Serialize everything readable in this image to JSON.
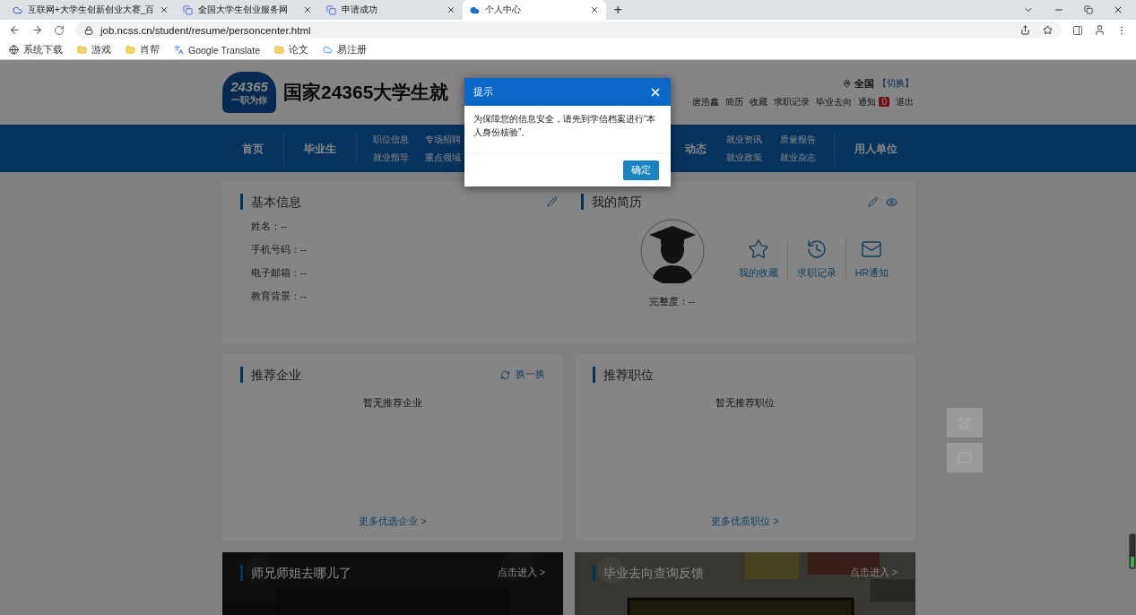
{
  "browser": {
    "tabs": [
      {
        "title": "互联网+大学生创新创业大赛_百",
        "selected": false
      },
      {
        "title": "全国大学生创业服务网",
        "selected": false
      },
      {
        "title": "申请成功",
        "selected": false
      },
      {
        "title": "个人中心",
        "selected": true
      }
    ],
    "new_tab": "+",
    "url": "job.ncss.cn/student/resume/personcenter.html",
    "bookmarks": [
      "系统下载",
      "游戏",
      "肖帮",
      "Google Translate",
      "论文",
      "易注册"
    ]
  },
  "header": {
    "logo_number": "24365",
    "logo_slogan": "一职为你",
    "site_title": "国家24365大学生就",
    "location": "全国",
    "switch": "【切换】",
    "user_links": [
      {
        "label": "唐浩鑫",
        "kind": "user"
      },
      {
        "label": "简历",
        "kind": "link"
      },
      {
        "label": "收藏",
        "kind": "link"
      },
      {
        "label": "求职记录",
        "kind": "link"
      },
      {
        "label": "毕业去向",
        "kind": "link"
      },
      {
        "label": "通知",
        "kind": "notice",
        "badge": "0"
      },
      {
        "label": "退出",
        "kind": "link"
      }
    ]
  },
  "nav": {
    "left": [
      {
        "label": "首页"
      },
      {
        "label": "毕业生"
      }
    ],
    "left_sub": [
      [
        "职位信息",
        "就业指导"
      ],
      [
        "专场招聘",
        "重点领域"
      ]
    ],
    "partial": "动态",
    "right_sub": [
      [
        "就业资讯",
        "就业政策"
      ],
      [
        "质量报告",
        "就业杂志"
      ]
    ],
    "right": [
      {
        "label": "用人单位"
      }
    ]
  },
  "basic_info": {
    "title": "基本信息",
    "fields": [
      "姓名：--",
      "手机号码：--",
      "电子邮箱：--",
      "教育背景：--"
    ]
  },
  "resume": {
    "title": "我的简历",
    "completeness": "完整度：--",
    "actions": [
      "我的收藏",
      "求职记录",
      "HR通知"
    ]
  },
  "recommended_companies": {
    "title": "推荐企业",
    "refresh": "换一换",
    "empty": "暂无推荐企业",
    "more": "更多优选企业 >"
  },
  "recommended_jobs": {
    "title": "推荐职位",
    "empty": "暂无推荐职位",
    "more": "更多优质职位 >"
  },
  "banners": [
    {
      "title": "师兄师姐去哪儿了",
      "link": "点击进入 >",
      "kind": "dark"
    },
    {
      "title": "毕业去向查询反馈",
      "link": "点击进入 >",
      "kind": "wall"
    }
  ],
  "dialog": {
    "title": "提示",
    "message": "为保障您的信息安全，请先到学信档案进行“本人身份核验”。",
    "button": "确定"
  }
}
